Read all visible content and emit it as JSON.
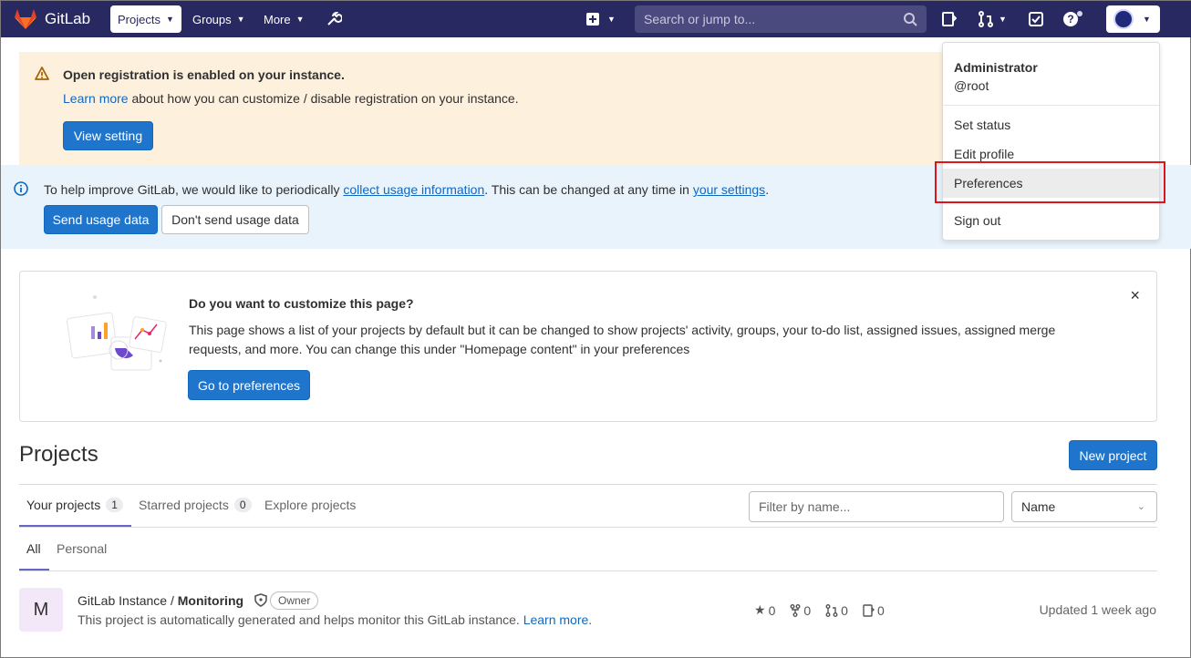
{
  "navbar": {
    "brand": "GitLab",
    "projects": "Projects",
    "groups": "Groups",
    "more": "More",
    "search_placeholder": "Search or jump to..."
  },
  "registration_alert": {
    "title": "Open registration is enabled on your instance.",
    "link": "Learn more",
    "body": " about how you can customize / disable registration on your instance.",
    "button": "View setting"
  },
  "usage_alert": {
    "text_before": "To help improve GitLab, we would like to periodically ",
    "link1": "collect usage information",
    "text_middle": ". This can be changed at any time in ",
    "link2": "your settings",
    "text_after": ".",
    "send_button": "Send usage data",
    "dont_send_button": "Don't send usage data"
  },
  "customize_card": {
    "title": "Do you want to customize this page?",
    "body": "This page shows a list of your projects by default but it can be changed to show projects' activity, groups, your to-do list, assigned issues, assigned merge requests, and more. You can change this under \"Homepage content\" in your preferences",
    "button": "Go to preferences",
    "close": "×"
  },
  "projects": {
    "title": "Projects",
    "new_button": "New project",
    "tabs": [
      {
        "label": "Your projects",
        "count": "1"
      },
      {
        "label": "Starred projects",
        "count": "0"
      },
      {
        "label": "Explore projects"
      }
    ],
    "filter_placeholder": "Filter by name...",
    "sort": "Name",
    "subtabs": [
      "All",
      "Personal"
    ],
    "items": [
      {
        "avatar": "M",
        "namespace": "GitLab Instance / ",
        "name": "Monitoring",
        "role": "Owner",
        "description": "This project is automatically generated and helps monitor this GitLab instance. ",
        "learn_more": "Learn more.",
        "stars": "0",
        "forks": "0",
        "merge_requests": "0",
        "issues": "0",
        "updated": "Updated 1 week ago"
      }
    ]
  },
  "user_menu": {
    "name": "Administrator",
    "username": "@root",
    "items": [
      "Set status",
      "Edit profile",
      "Preferences",
      "Sign out"
    ]
  },
  "colors": {
    "navbar": "#292961",
    "primary": "#1f75cb",
    "highlight": "#e0141b"
  }
}
